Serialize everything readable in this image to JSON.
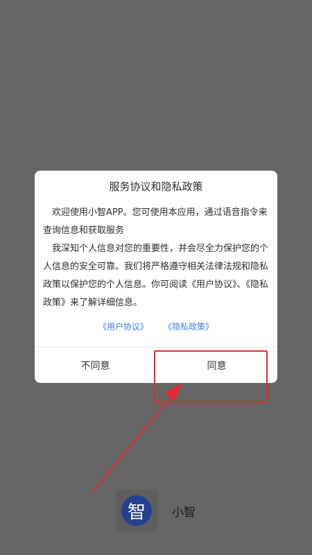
{
  "dialog": {
    "title": "服务协议和隐私政策",
    "paragraph1": "欢迎使用小智APP。您可使用本应用，通过语音指令来查询信息和获取服务",
    "paragraph2": "我深知个人信息对您的重要性，并会尽全力保护您的个人信息的安全可靠。我们将严格遵守相关法律法规和隐私政策以保护您的个人信息。你可阅读《用户协议》、《隐私政策》来了解详细信息。",
    "link_user_agreement": "《用户协议》",
    "link_privacy_policy": "《隐私政策》",
    "disagree_label": "不同意",
    "agree_label": "同意"
  },
  "app": {
    "icon_char": "智",
    "name": "小智",
    "icon_color": "#24418f"
  },
  "colors": {
    "overlay": "#666666",
    "link": "#3a7ef0",
    "annotation": "#e8262b"
  }
}
